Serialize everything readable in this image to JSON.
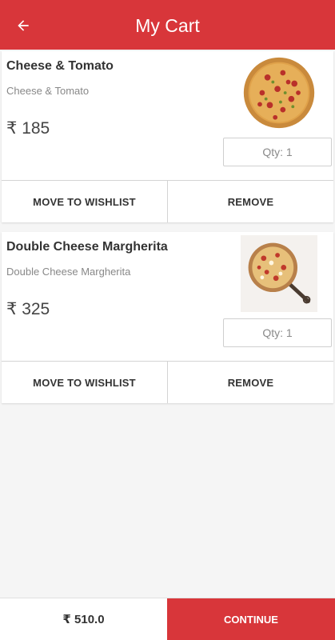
{
  "header": {
    "title": "My Cart",
    "back_icon": "arrow-left-icon",
    "background": "#d8363a"
  },
  "items": [
    {
      "name": "Cheese & Tomato",
      "description": "Cheese & Tomato",
      "price": "₹ 185",
      "quantity": "Qty: 1",
      "image_icon": "pizza-image",
      "wishlist_label": "MOVE TO WISHLIST",
      "remove_label": "REMOVE"
    },
    {
      "name": "Double Cheese Margherita",
      "description": "Double Cheese Margherita",
      "price": "₹ 325",
      "quantity": "Qty: 1",
      "image_icon": "pizza-on-paddle-image",
      "wishlist_label": "MOVE TO WISHLIST",
      "remove_label": "REMOVE"
    }
  ],
  "footer": {
    "total": "₹ 510.0",
    "continue_label": "CONTINUE",
    "accent": "#d8363a"
  }
}
